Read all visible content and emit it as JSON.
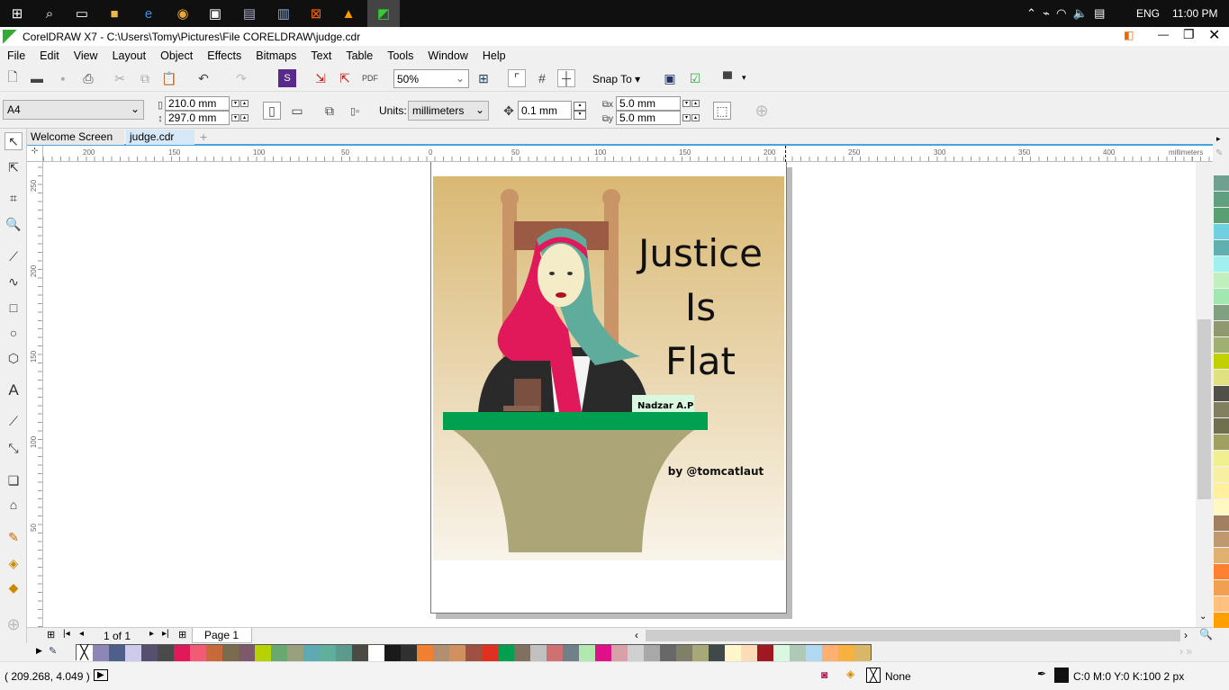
{
  "taskbar": {
    "time": "11:00 PM",
    "language": "ENG",
    "icons": [
      "windows-start-icon",
      "search-icon",
      "task-view-icon",
      "file-explorer-icon",
      "edge-icon",
      "chrome-icon",
      "store-icon",
      "photos-icon",
      "notepad-icon",
      "xampp-icon",
      "vlc-icon",
      "coreldraw-icon"
    ]
  },
  "window": {
    "title": "CorelDRAW X7 - C:\\Users\\Tomy\\Pictures\\File CORELDRAW\\judge.cdr"
  },
  "menu": [
    "File",
    "Edit",
    "View",
    "Layout",
    "Object",
    "Effects",
    "Bitmaps",
    "Text",
    "Table",
    "Tools",
    "Window",
    "Help"
  ],
  "toolbar": {
    "zoom": "50%",
    "snap_to": "Snap To"
  },
  "propbar": {
    "page_size": "A4",
    "width": "210.0 mm",
    "height": "297.0 mm",
    "units_label": "Units:",
    "units": "millimeters",
    "nudge": "0.1 mm",
    "dup_x": "5.0 mm",
    "dup_y": "5.0 mm"
  },
  "tabs": [
    {
      "label": "Welcome Screen",
      "active": false
    },
    {
      "label": "judge.cdr",
      "active": true
    }
  ],
  "ruler": {
    "unit": "millimeters",
    "top": [
      "200",
      "150",
      "100",
      "50",
      "0",
      "50",
      "100",
      "150",
      "200",
      "250",
      "300",
      "350",
      "400"
    ],
    "left": [
      "250",
      "200",
      "150",
      "100",
      "50"
    ]
  },
  "artwork": {
    "title_lines": [
      "Justice",
      "Is",
      "Flat"
    ],
    "nameplate": "Nadzar A.P",
    "credit": "by @tomcatlaut"
  },
  "pagenav": {
    "page_of": "1 of 1",
    "page_tab": "Page 1"
  },
  "status": {
    "coords": "( 209.268, 4.049 )",
    "fill": "None",
    "outline": "C:0 M:0 Y:0 K:100  2 px"
  },
  "palette_bottom": [
    "#8e86b4",
    "#4e5f8b",
    "#cccbec",
    "#574f6e",
    "#4a4a4a",
    "#e0195a",
    "#f35b75",
    "#c8693a",
    "#7a6b4f",
    "#7c5a6a",
    "#b6d300",
    "#6aa872",
    "#98a07e",
    "#5eaab2",
    "#5faf9c",
    "#5b9a8c",
    "#4b4a44",
    "#ffffff",
    "#1a1a1a",
    "#303030",
    "#f08030",
    "#b09070",
    "#d09060",
    "#a05040",
    "#e03020",
    "#00a050",
    "#807060",
    "#c0c0c0",
    "#d07070",
    "#708088",
    "#b0e8b0",
    "#e0108a",
    "#d8a0a8",
    "#d0d0d0",
    "#a8a8a8",
    "#686868",
    "#808068",
    "#a8a878",
    "#404848",
    "#fff6cc",
    "#fddcb8",
    "#a01820",
    "#d8f8e0",
    "#b0c8b8",
    "#b0d8f0",
    "#ffb070",
    "#f8b040",
    "#d8b868"
  ],
  "palette_right": [
    "#70a090",
    "#60a080",
    "#58a070",
    "#70d0e0",
    "#60b0b0",
    "#a0f0f0",
    "#c0f0c0",
    "#a0e8b0",
    "#80a080",
    "#909870",
    "#a0b070",
    "#c0d000",
    "#e0e080",
    "#505048",
    "#808060",
    "#707050",
    "#a0a060",
    "#f0f090",
    "#f8f0a0",
    "#fff0a0",
    "#fff8c0",
    "#a08060",
    "#c09870",
    "#e0b070",
    "#ff8030",
    "#f0a050",
    "#ffc080",
    "#ffa000"
  ],
  "colors": {
    "accent": "#4aa3df",
    "taskbar": "#101010"
  }
}
